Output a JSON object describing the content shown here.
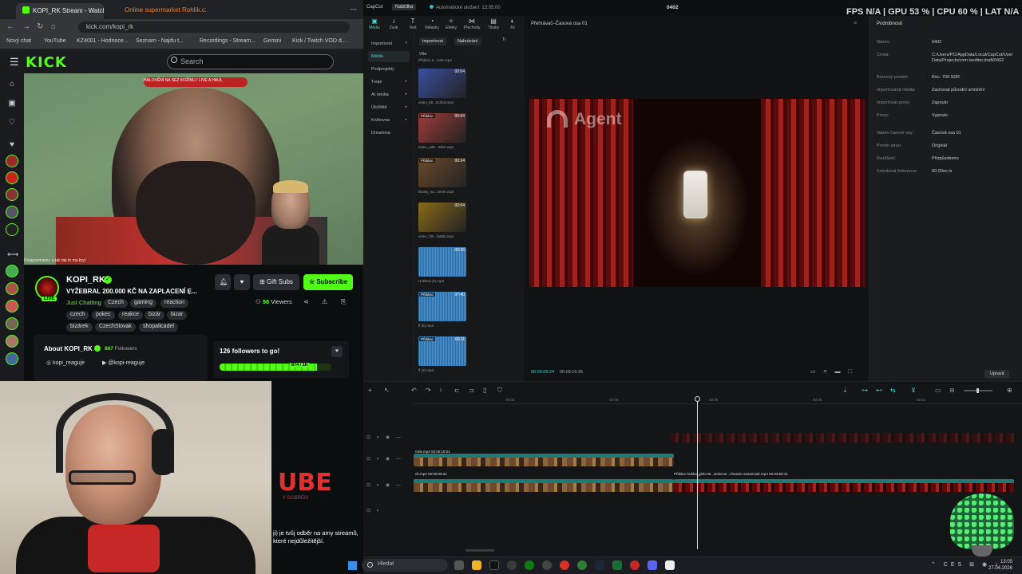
{
  "browser": {
    "tabs": [
      {
        "title": "KOPI_RK Stream - Watch",
        "active": true
      },
      {
        "title": "Online supermarket Rohlík.cz",
        "active": false
      }
    ],
    "url": "kick.com/kopi_rk",
    "bookmarks": [
      "Nový chat",
      "YouTube",
      "KZ4001 - Hodnoce...",
      "Seznam - Najdu t...",
      "Recordings - Stream...",
      "Gemini",
      "Kick / Twitch VOD d..."
    ],
    "search_placeholder": "Search",
    "logo": "KICK",
    "video_banner": "HALOVĚNÍ NA SEZ KOŽÍNU / LIVE A HAUL",
    "chat_overlay": "Petapesmaniu: a tak tak to mu kryt",
    "channel": {
      "name": "KOPI_RK",
      "live_badge": "LIVE",
      "title": "VYŽEBRAL 200.000 KČ NA ZAPLACENÍ E...",
      "category": "Just Chatting",
      "tags": [
        "Czech",
        "gaming",
        "reaction",
        "czech",
        "pokec",
        "reakce",
        "bizár",
        "bizar",
        "bizárek",
        "CzechSlovak",
        "shopalicadel"
      ],
      "viewers_count": "98",
      "viewers_label": "Viewers",
      "gift_label": "Gift Subs",
      "subscribe_label": "Subscribe"
    },
    "about": {
      "title": "About KOPI_RK",
      "followers_count": "867",
      "followers_label": "Followers",
      "instagram": "kopi_reaguje",
      "youtube": "@kopi-reaguje"
    },
    "goal": {
      "title": "126 followers to go!",
      "label": "874 / 1K",
      "progress": 0.874
    }
  },
  "overlay": {
    "ube": "UBE",
    "ube_sub": "V DOBRÉM",
    "promo": "ji) je tvůj odběr na amy streamů, které nejdůležitější."
  },
  "capcut": {
    "logo": "CapCut",
    "menu": "Nabídka",
    "autosave": "Automatické uložení: 13:05:00",
    "project_name": "0402",
    "osd": "FPS N/A  |  GPU 53 %  |  CPU 60 %  |  LAT N/A",
    "tools": [
      {
        "label": "Média",
        "icon": "media-icon",
        "glyph": "▣",
        "active": true
      },
      {
        "label": "Zvuk",
        "icon": "audio-icon",
        "glyph": "♪",
        "active": false
      },
      {
        "label": "Text",
        "icon": "text-icon",
        "glyph": "T",
        "active": false
      },
      {
        "label": "Nálepky",
        "icon": "sticker-icon",
        "glyph": "◔",
        "active": false
      },
      {
        "label": "Efekty",
        "icon": "effects-icon",
        "glyph": "✧",
        "active": false
      },
      {
        "label": "Přechody",
        "icon": "transitions-icon",
        "glyph": "⋈",
        "active": false
      },
      {
        "label": "Titulky",
        "icon": "captions-icon",
        "glyph": "▤",
        "active": false
      },
      {
        "label": "Fil",
        "icon": "filters-icon",
        "glyph": "◐",
        "active": false
      }
    ],
    "sidenav": [
      {
        "label": "Importovat",
        "sel": false,
        "arrow": "▾"
      },
      {
        "label": "Média",
        "sel": true,
        "arrow": ""
      },
      {
        "label": "Podprojekty",
        "sel": false,
        "arrow": ""
      },
      {
        "label": "Tvoje",
        "sel": false,
        "arrow": "▸"
      },
      {
        "label": "AI média",
        "sel": false,
        "arrow": "▸"
      },
      {
        "label": "Úložiště",
        "sel": false,
        "arrow": "▸"
      },
      {
        "label": "Knihovna",
        "sel": false,
        "arrow": "▸"
      },
      {
        "label": "Dreamina",
        "sel": false,
        "arrow": ""
      }
    ],
    "media_import": "Importovat",
    "media_view": "Nahrávání",
    "media_filter": "Tr",
    "media_all": "Vše",
    "media_first_name": "Přidáno a...nrek.mp4",
    "media": [
      {
        "name": "video_5tt...5c2b4.mp4",
        "dur": "00:04",
        "added": "",
        "kind": "video",
        "color": "#3a4fa0"
      },
      {
        "name": "video_ad9...9ab0.mp4",
        "dur": "00:04",
        "added": "Přidáno",
        "kind": "video",
        "color": "#a03b3b"
      },
      {
        "name": "Booky_ka...vnrek.mp4",
        "dur": "00:34",
        "added": "Přidáno",
        "kind": "video",
        "color": "#6a4a2a"
      },
      {
        "name": "video_f35...fa880.mp4",
        "dur": "00:04",
        "added": "",
        "kind": "video",
        "color": "#8a6a18"
      },
      {
        "name": "Untitled (3).mp3",
        "dur": "00:26",
        "added": "",
        "kind": "audio",
        "color": ""
      },
      {
        "name": "ff (5).mp3",
        "dur": "07:40",
        "added": "Přidáno",
        "kind": "audio",
        "color": ""
      },
      {
        "name": "ff (2).mp3",
        "dur": "00:11",
        "added": "Přidáno",
        "kind": "audio",
        "color": ""
      }
    ],
    "player": {
      "title": "Přehrávač–Časová osa 01",
      "watermark": "Agent",
      "timecode_current": "00:00:09:24",
      "timecode_total": "00:09:16:35",
      "controls": "▭ ⌗ ▬ ⛶"
    },
    "props": {
      "tab": "Podrobnosti",
      "rows": [
        {
          "label": "Název:",
          "value": "0402"
        },
        {
          "label": "Cesta:",
          "value": "C:/Users/PC/AppData/Local/CapCut/User Data/Projects/com.lveditor.draft/0402"
        },
        {
          "label": "Barevný prostor:",
          "value": "Rec. 709 SDR"
        },
        {
          "label": "Importovaná média:",
          "value": "Zachovat původní umístění"
        },
        {
          "label": "Importovat proxy:",
          "value": "Zapnuto"
        },
        {
          "label": "Proxy:",
          "value": "Vypnuto"
        },
        {
          "label": "Název časové osy:",
          "value": "Časová osa 01"
        },
        {
          "label": "Poměr stran:",
          "value": "Originál"
        },
        {
          "label": "Rozlišení:",
          "value": "Přizpůsobeno"
        },
        {
          "label": "Snímková frekvence:",
          "value": "60.00sn./s"
        }
      ],
      "modify_label": "Upravit"
    },
    "timeline": {
      "ruler": [
        "00:00",
        "00:03",
        "00:06",
        "00:09",
        "00:12"
      ],
      "clips": [
        {
          "label": "",
          "kind": "film-red"
        },
        {
          "label": "rnek.mp4  00:00:19:21",
          "kind": "film"
        },
        {
          "label": "ek.mp4  00:00:09:22",
          "kind": "film"
        },
        {
          "label": "Přidáno  kubka_glob-05...stniiznut...zhnacle-seasemak.mp4  00:33:59:31",
          "kind": "film-red"
        }
      ]
    }
  },
  "taskbar": {
    "search_placeholder": "Hledat",
    "tray": "⌃ CES ⊞ ◉ ♪",
    "time": "13:05",
    "date": "27.04.2026"
  }
}
